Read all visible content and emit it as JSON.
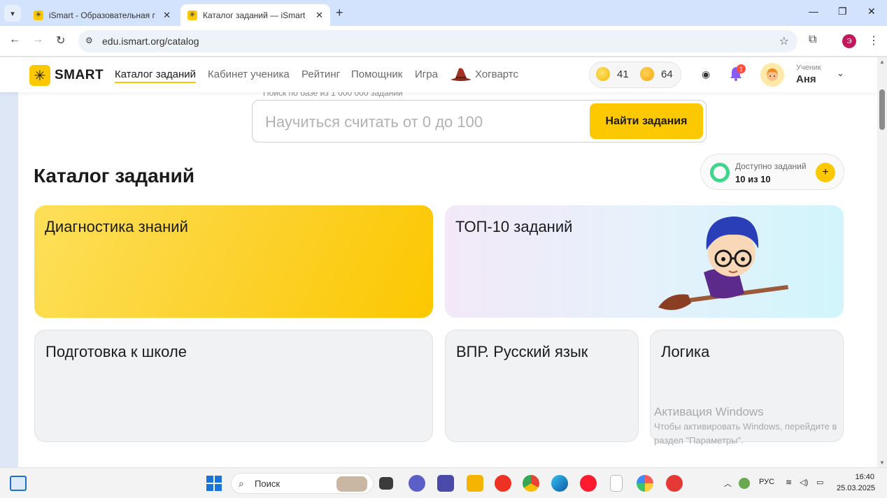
{
  "browser": {
    "tabs": [
      {
        "title": "iSmart - Образовательная пла"
      },
      {
        "title": "Каталог заданий — iSmart"
      }
    ],
    "url": "edu.ismart.org/catalog",
    "profile_initial": "Э"
  },
  "site": {
    "logo_text": "SMART",
    "nav": [
      {
        "label": "Каталог заданий",
        "active": true
      },
      {
        "label": "Кабинет ученика"
      },
      {
        "label": "Рейтинг"
      },
      {
        "label": "Помощник"
      },
      {
        "label": "Игра"
      },
      {
        "label": "Хогвартс"
      }
    ],
    "coins": "41",
    "smiles": "64",
    "notifications_count": "1",
    "user_role": "Ученик",
    "user_name": "Аня"
  },
  "search": {
    "hint": "Поиск по базе из 1 000 000 заданий",
    "placeholder": "Научиться считать от 0 до 100",
    "button_label": "Найти задания"
  },
  "catalog": {
    "title": "Каталог заданий",
    "available_label": "Доступно заданий",
    "available_value": "10 из 10",
    "cards": [
      {
        "title": "Диагностика знаний"
      },
      {
        "title": "ТОП-10 заданий"
      },
      {
        "title": "Подготовка к школе"
      },
      {
        "title": "ВПР. Русский язык"
      },
      {
        "title": "Логика"
      }
    ]
  },
  "windows_activation": {
    "title": "Активация Windows",
    "text_line1": "Чтобы активировать Windows, перейдите в",
    "text_line2": "раздел \"Параметры\"."
  },
  "taskbar": {
    "search_label": "Поиск",
    "language": "РУС",
    "time": "16:40",
    "date": "25.03.2025"
  },
  "colors": {
    "brand_yellow": "#fcc800",
    "accent_green": "#3dd68c"
  }
}
